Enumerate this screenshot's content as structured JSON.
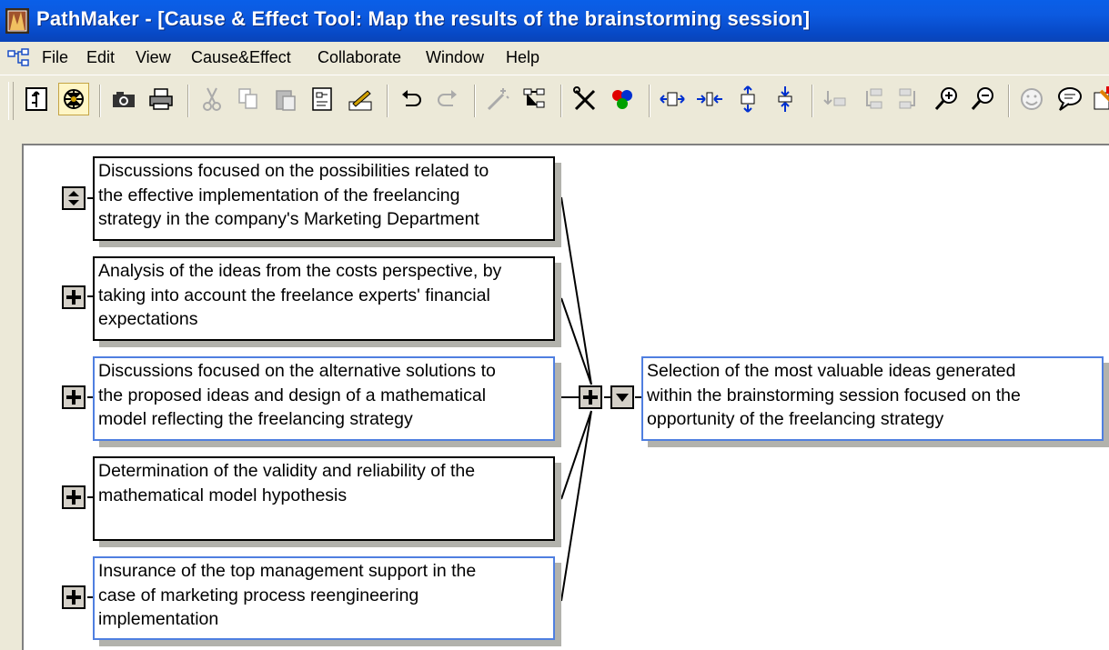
{
  "window": {
    "title": "PathMaker - [Cause & Effect Tool: Map the results of the brainstorming session]"
  },
  "menu": {
    "items": [
      "File",
      "Edit",
      "View",
      "Cause&Effect",
      "Collaborate",
      "Window",
      "Help"
    ]
  },
  "toolbar": {
    "icons": [
      "tree-view-icon",
      "fishbone-view-icon",
      "camera-icon",
      "print-icon",
      "cut-icon",
      "copy-icon",
      "paste-icon",
      "insert-object-icon",
      "edit-text-icon",
      "undo-icon",
      "redo-icon",
      "magic-wand-icon",
      "rearrange-icon",
      "tools-icon",
      "color-balls-icon",
      "expand-horizontal-icon",
      "contract-horizontal-icon",
      "expand-vertical-icon",
      "contract-vertical-icon",
      "move-down-icon",
      "indent-left-icon",
      "indent-right-icon",
      "zoom-in-icon",
      "zoom-out-icon",
      "smiley-icon",
      "comment-icon",
      "notes-icon"
    ]
  },
  "diagram": {
    "causes": [
      {
        "lines": [
          "Discussions focused on the possibilities related to",
          "the effective implementation of the freelancing",
          "strategy in the company's Marketing Department"
        ]
      },
      {
        "lines": [
          "Analysis of the ideas from the costs perspective, by",
          "taking into account the freelance experts' financial",
          "expectations"
        ]
      },
      {
        "lines": [
          "Discussions focused on the alternative solutions to",
          "the proposed ideas and design of a mathematical",
          "model reflecting the freelancing strategy"
        ]
      },
      {
        "lines": [
          "Determination of the validity and reliability of the",
          "mathematical model hypothesis"
        ]
      },
      {
        "lines": [
          "Insurance of the top management support in the",
          "case of marketing process reengineering",
          "implementation"
        ]
      }
    ],
    "effect": {
      "lines": [
        "Selection of the most valuable ideas generated",
        "within the brainstorming session focused on the",
        "opportunity of the freelancing strategy"
      ]
    }
  },
  "colors": {
    "title_bar": "#0a5fe8",
    "selected_border": "#4f7fe0",
    "box_shadow": "#b2b2ac"
  }
}
